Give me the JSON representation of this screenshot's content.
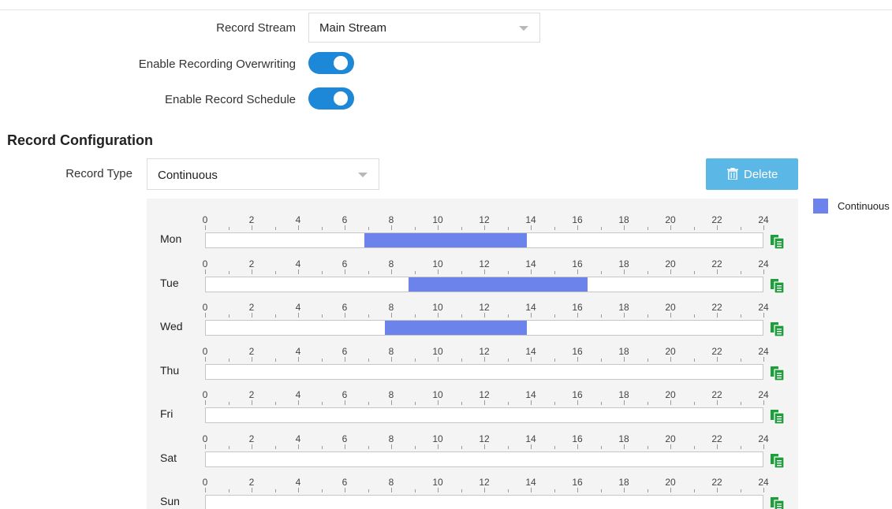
{
  "form": {
    "record_stream_label": "Record Stream",
    "record_stream_value": "Main Stream",
    "overwrite_label": "Enable Recording Overwriting",
    "overwrite_on": true,
    "schedule_label": "Enable Record Schedule",
    "schedule_on": true
  },
  "record_config": {
    "title": "Record Configuration",
    "type_label": "Record Type",
    "type_value": "Continuous",
    "delete_label": "Delete",
    "legend_label": "Continuous",
    "legend_color": "#6d83ec",
    "toggle_color": "#1e88d8",
    "delete_color": "#5bb8e6",
    "copy_icon_color": "#1e9e3a"
  },
  "schedule": {
    "ticks": [
      "0",
      "2",
      "4",
      "6",
      "8",
      "10",
      "12",
      "14",
      "16",
      "18",
      "20",
      "22",
      "24"
    ],
    "days": [
      {
        "label": "Mon",
        "segments": [
          {
            "start": 6.8,
            "end": 13.8
          }
        ]
      },
      {
        "label": "Tue",
        "segments": [
          {
            "start": 8.7,
            "end": 16.4
          }
        ]
      },
      {
        "label": "Wed",
        "segments": [
          {
            "start": 7.7,
            "end": 13.8
          }
        ]
      },
      {
        "label": "Thu",
        "segments": []
      },
      {
        "label": "Fri",
        "segments": []
      },
      {
        "label": "Sat",
        "segments": []
      },
      {
        "label": "Sun",
        "segments": []
      }
    ]
  }
}
